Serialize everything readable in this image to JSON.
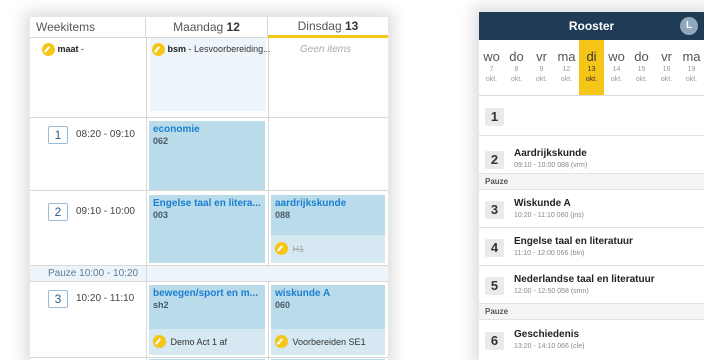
{
  "desktop": {
    "header": {
      "weekitems": "Weekitems",
      "mon_name": "Maandag",
      "mon_num": "12",
      "tue_name": "Dinsdag",
      "tue_num": "13"
    },
    "weekitem_note": {
      "user": "maat",
      "text": "-"
    },
    "mon_note": {
      "user": "bsm",
      "text": "- Lesvoorbereiding..."
    },
    "tue_empty": "Geen items",
    "rows": [
      {
        "num": "1",
        "time": "08:20 - 09:10"
      },
      {
        "num": "2",
        "time": "09:10 - 10:00"
      },
      {
        "num": "3",
        "time": "10:20 - 11:10"
      }
    ],
    "pauze": "Pauze  10:00 - 10:20",
    "lessons": {
      "mon1": {
        "subject": "economie",
        "room": "062"
      },
      "mon2": {
        "subject": "Engelse taal en litera...",
        "room": "003"
      },
      "tue2": {
        "subject": "aardrijkskunde",
        "room": "088",
        "tag": "H1"
      },
      "mon3": {
        "subject": "bewegen/sport en m...",
        "room": "sh2",
        "tag": "Demo Act 1 af"
      },
      "tue3": {
        "subject": "wiskunde A",
        "room": "060",
        "tag": "Voorbereiden SE1"
      }
    }
  },
  "mobile": {
    "title": "Rooster",
    "avatar": "L",
    "days": [
      {
        "name": "wo",
        "date": "7",
        "month": "okt."
      },
      {
        "name": "do",
        "date": "8",
        "month": "okt."
      },
      {
        "name": "vr",
        "date": "9",
        "month": "okt."
      },
      {
        "name": "ma",
        "date": "12",
        "month": "okt."
      },
      {
        "name": "di",
        "date": "13",
        "month": "okt."
      },
      {
        "name": "wo",
        "date": "14",
        "month": "okt."
      },
      {
        "name": "do",
        "date": "15",
        "month": "okt."
      },
      {
        "name": "vr",
        "date": "16",
        "month": "okt."
      },
      {
        "name": "ma",
        "date": "19",
        "month": "okt."
      }
    ],
    "selected_day": 4,
    "lessons": [
      {
        "num": "1",
        "subject": "",
        "info": ""
      },
      {
        "num": "2",
        "subject": "Aardrijkskunde",
        "info": "09:10 - 10:00     088 (vrm)"
      },
      {
        "num": "3",
        "subject": "Wiskunde A",
        "info": "10:20 - 11:10     060 (jns)"
      },
      {
        "num": "4",
        "subject": "Engelse taal en literatuur",
        "info": "11:10 - 12:00     066 (bin)"
      },
      {
        "num": "5",
        "subject": "Nederlandse taal en literatuur",
        "info": "12:00 - 12:50     058 (smn)"
      },
      {
        "num": "6",
        "subject": "Geschiedenis",
        "info": "13:20 - 14:10     066 (cle)"
      }
    ],
    "pauze1": "Pauze",
    "pauze2": "Pauze"
  },
  "colors": {
    "accent": "#f5c518",
    "lesson_bg": "#b9dbea",
    "header_bar": "#1f3b55",
    "link": "#1a7fd1"
  }
}
